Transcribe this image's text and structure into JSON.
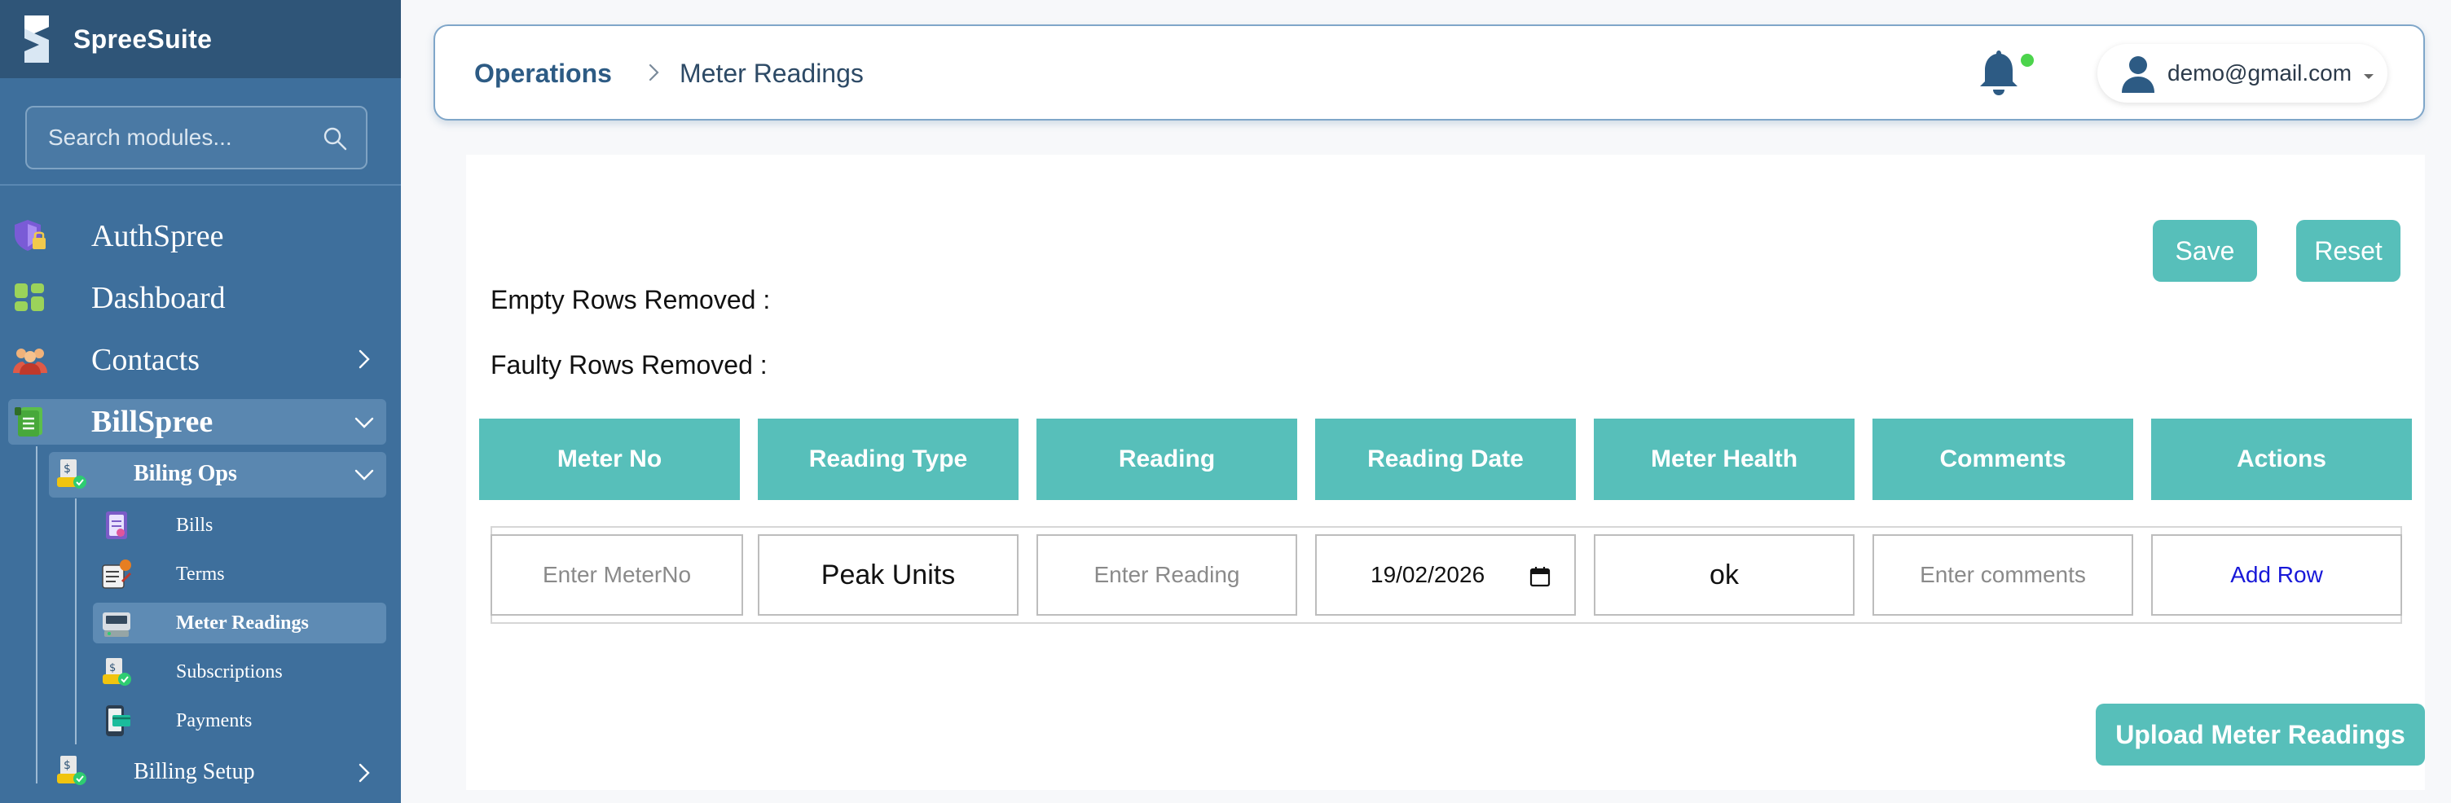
{
  "app": {
    "brand_name": "SpreeSuite",
    "colors": {
      "sidebar": "#3e6f9c",
      "sidebar_header": "#2f5578",
      "accent_teal": "#57bfba",
      "breadcrumb": "#2d5b84",
      "link": "#1818d8"
    }
  },
  "sidebar": {
    "search_placeholder": "Search modules...",
    "items": [
      {
        "label": "AuthSpree",
        "icon": "shield-lock-icon"
      },
      {
        "label": "Dashboard",
        "icon": "dashboard-grid-icon"
      },
      {
        "label": "Contacts",
        "icon": "team-icon",
        "expandable": true
      },
      {
        "label": "BillSpree",
        "icon": "ledger-icon",
        "expanded": true
      }
    ],
    "billspree_children": [
      {
        "label": "Biling Ops",
        "icon": "billing-ops-icon",
        "expanded": true
      },
      {
        "label": "Billing Setup",
        "icon": "billing-setup-icon",
        "expandable": true
      }
    ],
    "billing_ops_children": [
      {
        "label": "Bills",
        "icon": "bill-document-icon"
      },
      {
        "label": "Terms",
        "icon": "terms-icon"
      },
      {
        "label": "Meter Readings",
        "icon": "meter-reading-icon",
        "active": true
      },
      {
        "label": "Subscriptions",
        "icon": "subscription-icon"
      },
      {
        "label": "Payments",
        "icon": "payment-icon"
      }
    ]
  },
  "header": {
    "breadcrumb_root": "Operations",
    "breadcrumb_current": "Meter Readings",
    "user_email": "demo@gmail.com"
  },
  "main": {
    "save_label": "Save",
    "reset_label": "Reset",
    "empty_rows_label": "Empty Rows Removed :",
    "faulty_rows_label": "Faulty Rows Removed :",
    "columns": [
      "Meter No",
      "Reading Type",
      "Reading",
      "Reading Date",
      "Meter Health",
      "Comments",
      "Actions"
    ],
    "row": {
      "meter_no_placeholder": "Enter MeterNo",
      "reading_type": "Peak Units",
      "reading_placeholder": "Enter Reading",
      "reading_date": "19/02/2026",
      "meter_health": "ok",
      "comments_placeholder": "Enter comments",
      "action_label": "Add Row"
    },
    "upload_label": "Upload Meter Readings"
  }
}
